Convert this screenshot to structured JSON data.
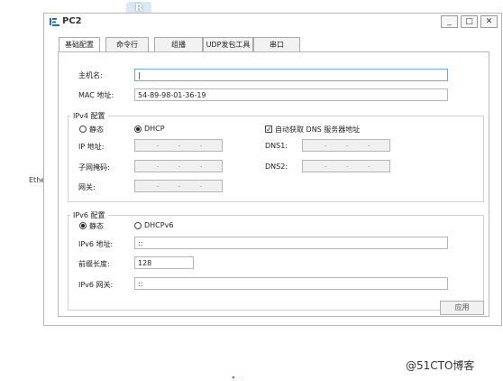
{
  "watermark": "@51CTO博客",
  "side_label": "Ethe",
  "window": {
    "title": "PC2",
    "controls": {
      "minimize": "_",
      "maximize": "□",
      "close": "✕"
    }
  },
  "tabs": [
    {
      "label": "基础配置",
      "active": true
    },
    {
      "label": "命令行"
    },
    {
      "label": "组播"
    },
    {
      "label": "UDP发包工具"
    },
    {
      "label": "串口"
    }
  ],
  "basic": {
    "hostname_label": "主机名:",
    "hostname_value": "|",
    "mac_label": "MAC 地址:",
    "mac_value": "54-89-98-01-36-19"
  },
  "ipv4": {
    "title": "IPv4 配置",
    "static_label": "静态",
    "dhcp_label": "DHCP",
    "auto_dns_label": "自动获取 DNS 服务器地址",
    "ip_label": "IP 地址:",
    "mask_label": "子网掩码:",
    "gateway_label": "网关:",
    "dns1_label": "DNS1:",
    "dns2_label": "DNS2:",
    "ip_dot": "."
  },
  "ipv6": {
    "title": "IPv6 配置",
    "static_label": "静态",
    "dhcpv6_label": "DHCPv6",
    "addr_label": "IPv6 地址:",
    "addr_value": "::",
    "prefix_label": "前缀长度:",
    "prefix_value": "128",
    "gateway_label": "IPv6 网关:",
    "gateway_value": "::"
  },
  "apply_label": "应用",
  "colors": {
    "focus_border": "#6aaad6",
    "disabled_fill": "#f0f0f0"
  }
}
